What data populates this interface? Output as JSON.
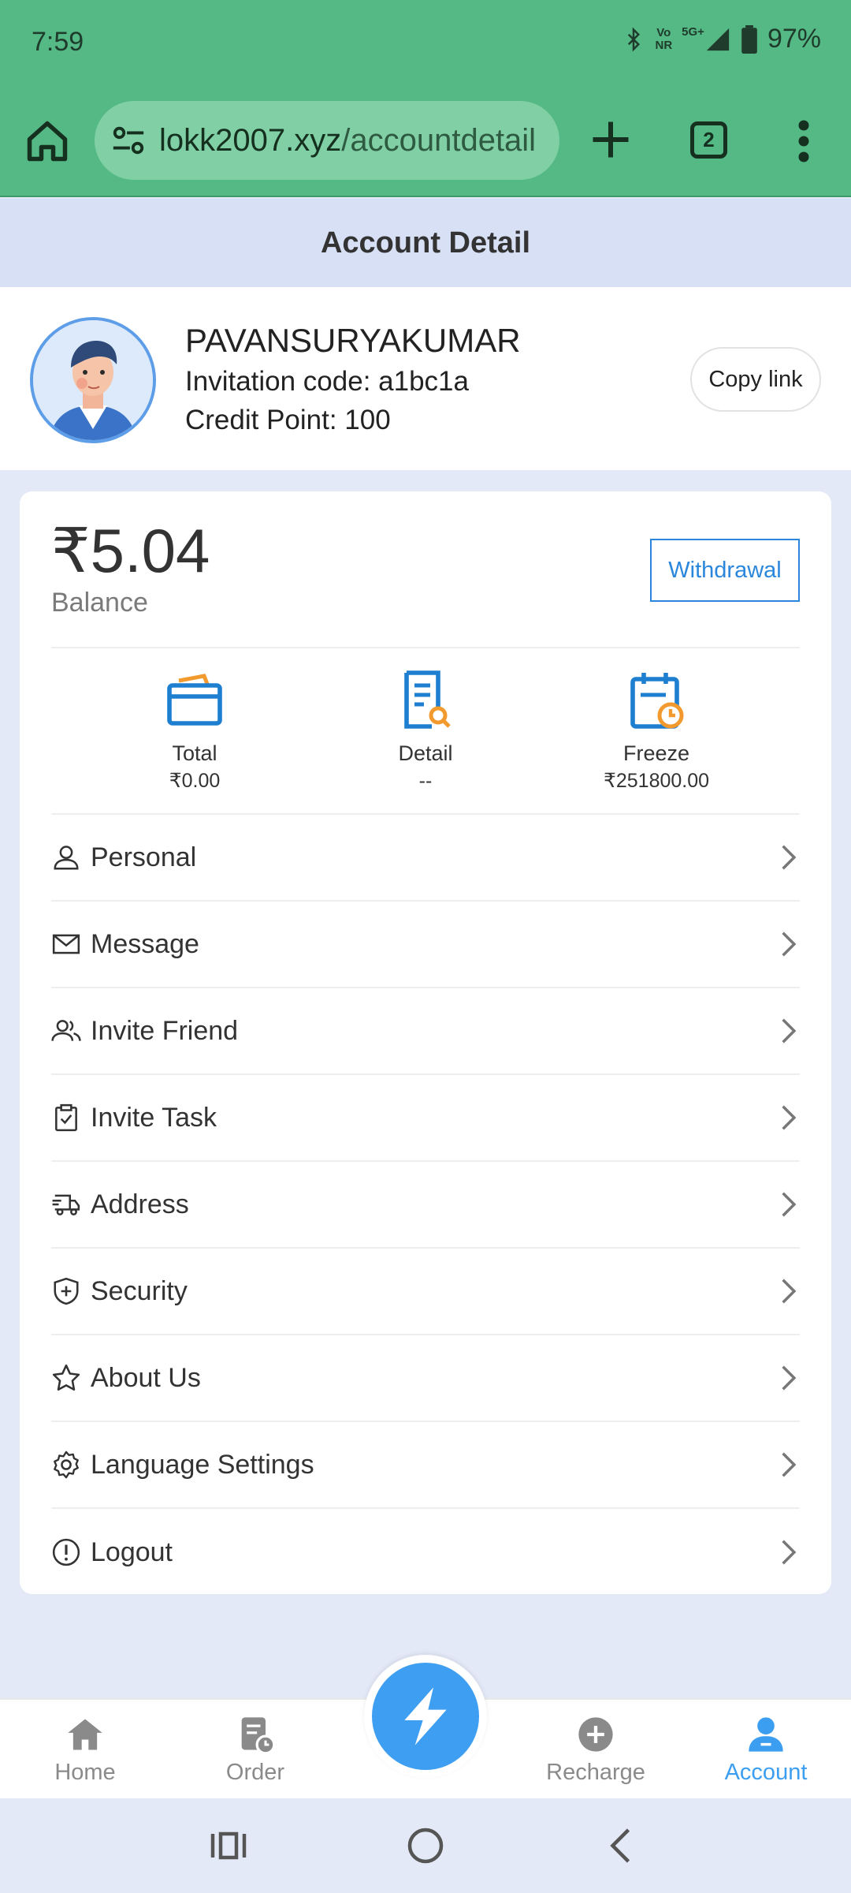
{
  "status_bar": {
    "time": "7:59",
    "network": "5G+",
    "volte_top": "Vo",
    "volte_bottom": "NR",
    "battery": "97%"
  },
  "browser": {
    "url_domain": "lokk2007.xyz",
    "url_path": "/accountdetail",
    "tab_count": "2"
  },
  "page": {
    "title": "Account Detail"
  },
  "profile": {
    "name": "PAVANSURYAKUMAR",
    "invitation": "Invitation code: a1bc1a",
    "credit": "Credit Point: 100",
    "copy_label": "Copy link"
  },
  "balance": {
    "amount": "₹5.04",
    "label": "Balance",
    "withdraw_label": "Withdrawal"
  },
  "stats": [
    {
      "label": "Total",
      "value": "₹0.00",
      "icon": "wallet-icon"
    },
    {
      "label": "Detail",
      "value": "--",
      "icon": "document-search-icon"
    },
    {
      "label": "Freeze",
      "value": "₹251800.00",
      "icon": "calendar-clock-icon"
    }
  ],
  "menu": [
    {
      "label": "Personal",
      "icon": "user-icon"
    },
    {
      "label": "Message",
      "icon": "mail-icon"
    },
    {
      "label": "Invite Friend",
      "icon": "users-icon"
    },
    {
      "label": "Invite Task",
      "icon": "clipboard-check-icon"
    },
    {
      "label": "Address",
      "icon": "truck-icon"
    },
    {
      "label": "Security",
      "icon": "shield-icon"
    },
    {
      "label": "About Us",
      "icon": "star-icon"
    },
    {
      "label": "Language Settings",
      "icon": "gear-icon"
    },
    {
      "label": "Logout",
      "icon": "alert-circle-icon"
    }
  ],
  "bottom_nav": {
    "items": [
      {
        "label": "Home",
        "icon": "home-icon"
      },
      {
        "label": "Order",
        "icon": "order-icon"
      },
      {
        "label": "Recharge",
        "icon": "plus-circle-icon"
      },
      {
        "label": "Account",
        "icon": "account-icon"
      }
    ],
    "active": "Account",
    "center_icon": "lightning-icon"
  },
  "colors": {
    "browser_green": "#55b985",
    "accent_blue": "#2b87dc",
    "nav_active": "#3c9ef0",
    "header_bg": "#d7e0f4",
    "page_bg": "#e3e9f7",
    "icon_orange": "#f29a2e"
  }
}
